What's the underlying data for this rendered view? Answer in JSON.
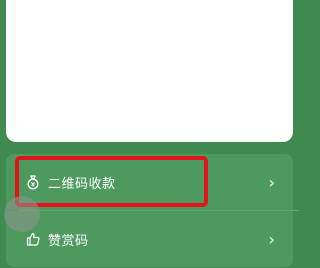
{
  "menu": {
    "items": [
      {
        "label": "二维码收款",
        "icon": "money-bag-icon"
      },
      {
        "label": "赞赏码",
        "icon": "thumb-up-icon"
      }
    ]
  },
  "colors": {
    "background": "#3f8a4f",
    "row": "#4e9a5e",
    "highlight": "#e1141c",
    "text": "#ffffff"
  }
}
